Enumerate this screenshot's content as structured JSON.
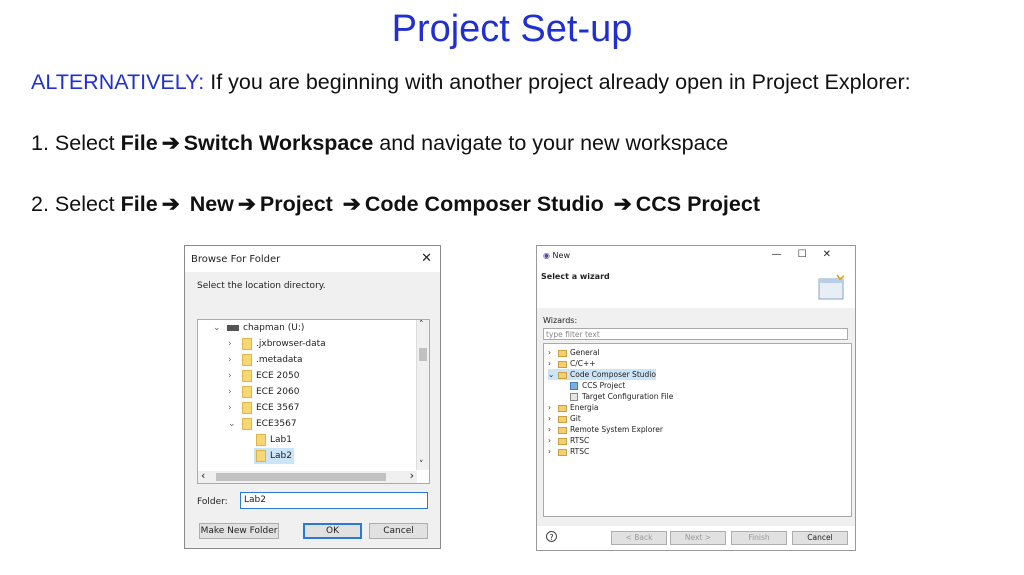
{
  "slide": {
    "title": "Project Set-up",
    "alt_label": "ALTERNATIVELY:",
    "alt_text": " If you are beginning with another project already open in Project Explorer:",
    "step1": {
      "prefix": "1.  Select ",
      "file": "File",
      "switch": "Switch Workspace",
      "suffix": " and navigate to your new workspace"
    },
    "step2": {
      "prefix": "2. Select ",
      "file": "File",
      "new": "New",
      "project": "Project",
      "ccs": "Code Composer Studio",
      "ccs_project": "CCS Project"
    }
  },
  "browse_dialog": {
    "title": "Browse For Folder",
    "close": "✕",
    "message": "Select the location directory.",
    "tree": [
      {
        "label": "chapman (U:)",
        "chev": "⌄",
        "icon": "drive"
      },
      {
        "label": ".jxbrowser-data",
        "chev": "›",
        "icon": "folder"
      },
      {
        "label": ".metadata",
        "chev": "›",
        "icon": "folder"
      },
      {
        "label": "ECE 2050",
        "chev": "›",
        "icon": "folder"
      },
      {
        "label": "ECE 2060",
        "chev": "›",
        "icon": "folder"
      },
      {
        "label": "ECE 3567",
        "chev": "›",
        "icon": "folder"
      },
      {
        "label": "ECE3567",
        "chev": "⌄",
        "icon": "folder"
      },
      {
        "label": "Lab1",
        "chev": "",
        "icon": "folder"
      },
      {
        "label": "Lab2",
        "chev": "",
        "icon": "folder",
        "selected": true
      }
    ],
    "scroll_up": "˄",
    "scroll_down": "˅",
    "scroll_left": "‹",
    "scroll_right": "›",
    "folder_label": "Folder:",
    "folder_value": "Lab2",
    "make_new_folder": "Make New Folder",
    "ok": "OK",
    "cancel": "Cancel"
  },
  "new_wizard": {
    "title": "New",
    "window_controls": "—☐✕",
    "subtitle": "Select a wizard",
    "wizards_label": "Wizards:",
    "filter_placeholder": "type filter text",
    "tree": [
      {
        "label": "General",
        "chev": "›",
        "icon": "folder"
      },
      {
        "label": "C/C++",
        "chev": "›",
        "icon": "folder"
      },
      {
        "label": "Code Composer Studio",
        "chev": "⌄",
        "icon": "folder",
        "selected": true
      },
      {
        "label": "CCS Project",
        "chev": "",
        "icon": "project"
      },
      {
        "label": "Target Configuration File",
        "chev": "",
        "icon": "file"
      },
      {
        "label": "Energia",
        "chev": "›",
        "icon": "folder"
      },
      {
        "label": "Git",
        "chev": "›",
        "icon": "folder"
      },
      {
        "label": "Remote System Explorer",
        "chev": "›",
        "icon": "folder"
      },
      {
        "label": "RTSC",
        "chev": "›",
        "icon": "folder"
      },
      {
        "label": "RTSC",
        "chev": "›",
        "icon": "folder"
      }
    ],
    "help": "?",
    "back": "< Back",
    "next": "Next >",
    "finish": "Finish",
    "cancel": "Cancel"
  }
}
